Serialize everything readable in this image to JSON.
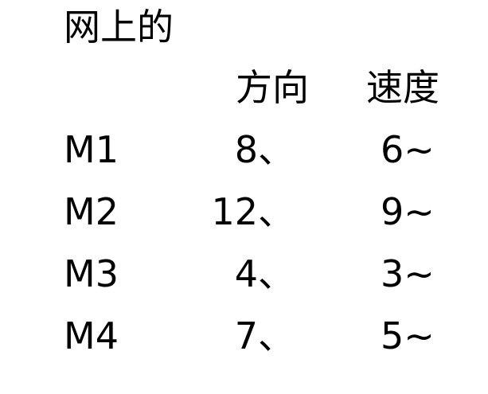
{
  "title": "网上的",
  "headers": {
    "direction": "方向",
    "speed": "速度"
  },
  "rows": [
    {
      "name": "M1",
      "direction": "8、",
      "speed": "6~"
    },
    {
      "name": "M2",
      "direction": "12、",
      "speed": "9~"
    },
    {
      "name": "M3",
      "direction": "4、",
      "speed": "3~"
    },
    {
      "name": "M4",
      "direction": "7、",
      "speed": "5~"
    }
  ]
}
